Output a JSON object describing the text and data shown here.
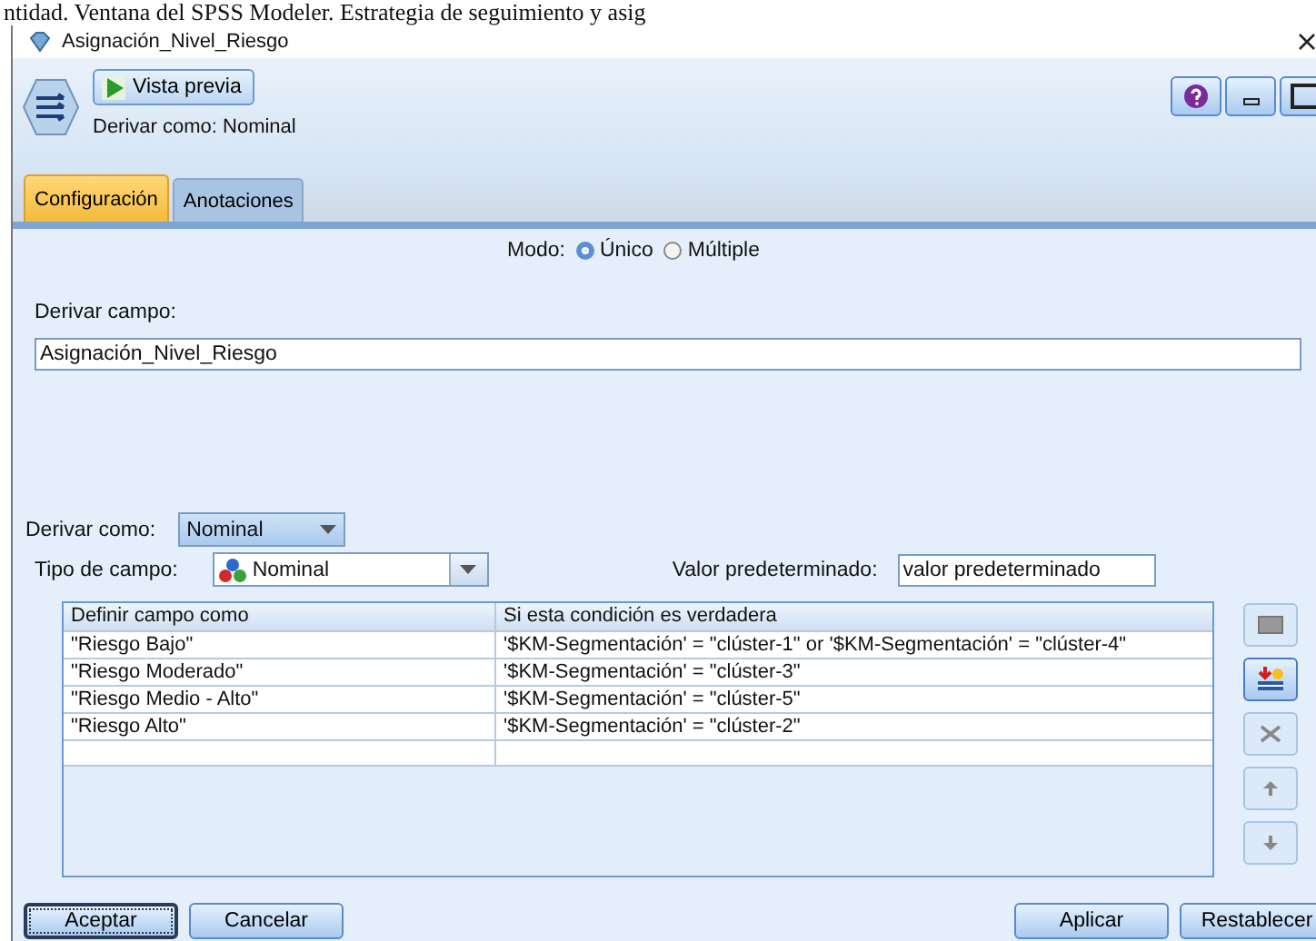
{
  "caption": "ntidad. Ventana del SPSS Modeler. Estrategia de seguimiento y asig",
  "window": {
    "title": "Asignación_Nivel_Riesgo"
  },
  "toolbar": {
    "preview_button": "Vista previa",
    "subtitle": "Derivar como: Nominal"
  },
  "tabs": [
    {
      "label": "Configuración",
      "selected": true
    },
    {
      "label": "Anotaciones",
      "selected": false
    }
  ],
  "mode": {
    "label": "Modo:",
    "options": [
      {
        "label": "Único",
        "selected": true
      },
      {
        "label": "Múltiple",
        "selected": false
      }
    ]
  },
  "derive_field": {
    "label": "Derivar campo:",
    "value": "Asignación_Nivel_Riesgo"
  },
  "derive_as": {
    "label": "Derivar como:",
    "value": "Nominal"
  },
  "field_type": {
    "label": "Tipo de campo:",
    "value": "Nominal"
  },
  "default_value": {
    "label": "Valor predeterminado:",
    "value": "valor predeterminado"
  },
  "table": {
    "columns": [
      "Definir campo como",
      "Si esta condición es verdadera"
    ],
    "rows": [
      [
        "\"Riesgo Bajo\"",
        "'$KM-Segmentación' = \"clúster-1\" or '$KM-Segmentación' = \"clúster-4\""
      ],
      [
        "\"Riesgo Moderado\"",
        "'$KM-Segmentación' = \"clúster-3\""
      ],
      [
        "\"Riesgo Medio - Alto\"",
        "'$KM-Segmentación' = \"clúster-5\""
      ],
      [
        "\"Riesgo Alto\"",
        "'$KM-Segmentación' = \"clúster-2\""
      ]
    ]
  },
  "side_buttons": [
    {
      "kind": "edit",
      "disabled": true
    },
    {
      "kind": "add",
      "disabled": false
    },
    {
      "kind": "delete",
      "disabled": true
    },
    {
      "kind": "up",
      "disabled": true
    },
    {
      "kind": "down",
      "disabled": true
    }
  ],
  "buttons_left": [
    {
      "label": "Aceptar",
      "focused": true
    },
    {
      "label": "Cancelar",
      "focused": false
    }
  ],
  "buttons_right": [
    {
      "label": "Aplicar",
      "focused": false
    },
    {
      "label": "Restablecer",
      "focused": false
    }
  ]
}
